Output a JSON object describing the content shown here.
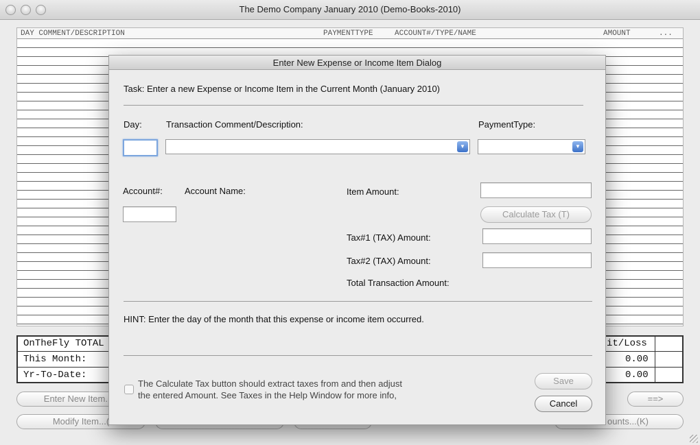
{
  "window": {
    "title": "The Demo Company  January 2010  (Demo-Books-2010)"
  },
  "ledger": {
    "columns": [
      "DAY COMMENT/DESCRIPTION",
      "PAYMENTTYPE",
      "ACCOUNT#/TYPE/NAME",
      "AMOUNT",
      "..."
    ]
  },
  "totals": {
    "header_left": "OnTheFly TOTAL",
    "header_right": "it/Loss",
    "row1_label": "This Month:",
    "row1_value": "0.00",
    "row2_label": "Yr-To-Date:",
    "row2_value": "0.00"
  },
  "bg_buttons": {
    "enter_new": "Enter New Item...",
    "modify": "Modify Item...(",
    "next": "==>",
    "accounts": "ounts...(K)"
  },
  "dialog": {
    "title": "Enter New Expense or Income Item Dialog",
    "task": "Task: Enter a new Expense or Income Item in the Current Month (January 2010)",
    "day_label": "Day:",
    "comment_label": "Transaction Comment/Description:",
    "paymenttype_label": "PaymentType:",
    "day_value": "",
    "comment_value": "",
    "paymenttype_value": "",
    "account_label": "Account#:",
    "account_name_label": "Account Name:",
    "account_value": "",
    "item_amount_label": "Item Amount:",
    "item_amount_value": "",
    "calc_tax_label": "Calculate Tax (T)",
    "tax1_label": "Tax#1 (TAX) Amount:",
    "tax1_value": "",
    "tax2_label": "Tax#2 (TAX) Amount:",
    "tax2_value": "",
    "total_label": "Total Transaction Amount:",
    "hint": "HINT: Enter the day of the month that this expense or income item occurred.",
    "checkbox_line1": "The Calculate Tax button should extract taxes from and then adjust",
    "checkbox_line2": "the entered Amount. See Taxes in the Help Window for more info,",
    "checkbox_checked": false,
    "save_label": "Save",
    "cancel_label": "Cancel"
  }
}
